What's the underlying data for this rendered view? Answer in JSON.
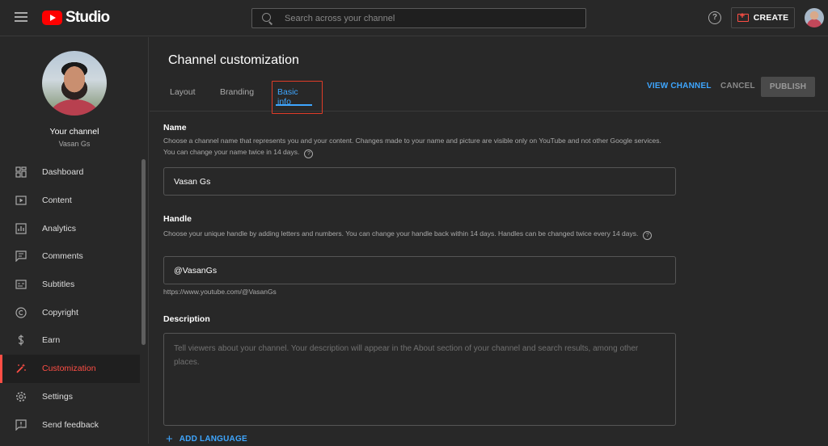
{
  "header": {
    "logo_text": "Studio",
    "search_placeholder": "Search across your channel",
    "help_glyph": "?",
    "create_label": "CREATE"
  },
  "sidebar": {
    "your_channel_label": "Your channel",
    "channel_name": "Vasan Gs",
    "items": [
      {
        "label": "Dashboard",
        "icon": "dashboard-icon"
      },
      {
        "label": "Content",
        "icon": "content-icon"
      },
      {
        "label": "Analytics",
        "icon": "analytics-icon"
      },
      {
        "label": "Comments",
        "icon": "comments-icon"
      },
      {
        "label": "Subtitles",
        "icon": "subtitles-icon"
      },
      {
        "label": "Copyright",
        "icon": "copyright-icon"
      },
      {
        "label": "Earn",
        "icon": "earn-icon"
      },
      {
        "label": "Customization",
        "icon": "customization-icon",
        "active": true
      },
      {
        "label": "Settings",
        "icon": "settings-icon"
      },
      {
        "label": "Send feedback",
        "icon": "feedback-icon"
      }
    ]
  },
  "main": {
    "title": "Channel customization",
    "tabs": [
      {
        "label": "Layout"
      },
      {
        "label": "Branding"
      },
      {
        "label": "Basic info",
        "active": true
      }
    ],
    "actions": {
      "view_channel": "VIEW CHANNEL",
      "cancel": "CANCEL",
      "publish": "PUBLISH"
    },
    "name": {
      "label": "Name",
      "description": "Choose a channel name that represents you and your content. Changes made to your name and picture are visible only on YouTube and not other Google services. You can change your name twice in 14 days.",
      "value": "Vasan Gs"
    },
    "handle": {
      "label": "Handle",
      "description": "Choose your unique handle by adding letters and numbers. You can change your handle back within 14 days. Handles can be changed twice every 14 days.",
      "value": "@VasanGs",
      "url": "https://www.youtube.com/@VasanGs"
    },
    "description": {
      "label": "Description",
      "placeholder": "Tell viewers about your channel. Your description will appear in the About section of your channel and search results, among other places.",
      "value": ""
    },
    "add_language_label": "ADD LANGUAGE"
  },
  "colors": {
    "accent_blue": "#3ea6ff",
    "active_red": "#ff4e45",
    "brand_red": "#ff0000",
    "highlight_box": "#e03c28"
  }
}
